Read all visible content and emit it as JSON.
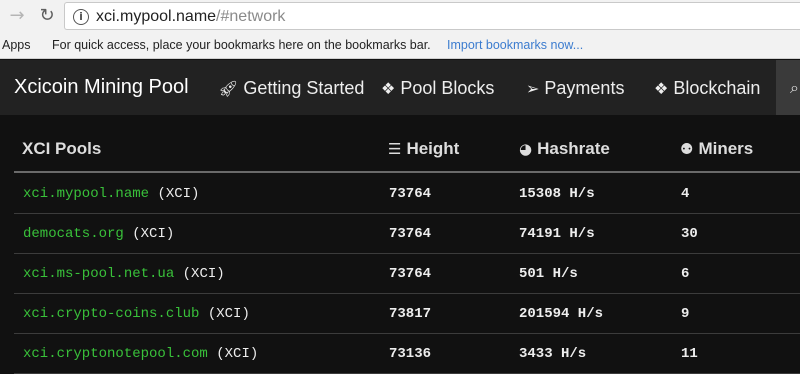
{
  "browser": {
    "url_host": "xci.mypool.name",
    "url_path": "/#network",
    "back_icon": "→",
    "reload_icon": "↻"
  },
  "bookmarks": {
    "apps_label": "Apps",
    "message": "For quick access, place your bookmarks here on the bookmarks bar.",
    "import_link": "Import bookmarks now..."
  },
  "navbar": {
    "brand": "Xcicoin Mining Pool",
    "items": [
      {
        "label": "Getting Started",
        "icon": "rocket-icon"
      },
      {
        "label": "Pool Blocks",
        "icon": "cubes-icon"
      },
      {
        "label": "Payments",
        "icon": "paper-plane-icon"
      },
      {
        "label": "Blockchain",
        "icon": "cubes-icon"
      }
    ]
  },
  "table": {
    "headers": {
      "pools": "XCI Pools",
      "height": "Height",
      "hashrate": "Hashrate",
      "miners": "Miners"
    },
    "rows": [
      {
        "pool": "xci.mypool.name",
        "symbol": "(XCI)",
        "height": "73764",
        "hashrate": "15308 H/s",
        "miners": "4"
      },
      {
        "pool": "democats.org",
        "symbol": "(XCI)",
        "height": "73764",
        "hashrate": "74191 H/s",
        "miners": "30"
      },
      {
        "pool": "xci.ms-pool.net.ua",
        "symbol": "(XCI)",
        "height": "73764",
        "hashrate": "501 H/s",
        "miners": "6"
      },
      {
        "pool": "xci.crypto-coins.club",
        "symbol": "(XCI)",
        "height": "73817",
        "hashrate": "201594 H/s",
        "miners": "9"
      },
      {
        "pool": "xci.cryptonotepool.com",
        "symbol": "(XCI)",
        "height": "73136",
        "hashrate": "3433 H/s",
        "miners": "11"
      }
    ]
  },
  "colors": {
    "link_green": "#39c13a",
    "navbar_bg": "#222222",
    "page_bg": "#111111"
  }
}
